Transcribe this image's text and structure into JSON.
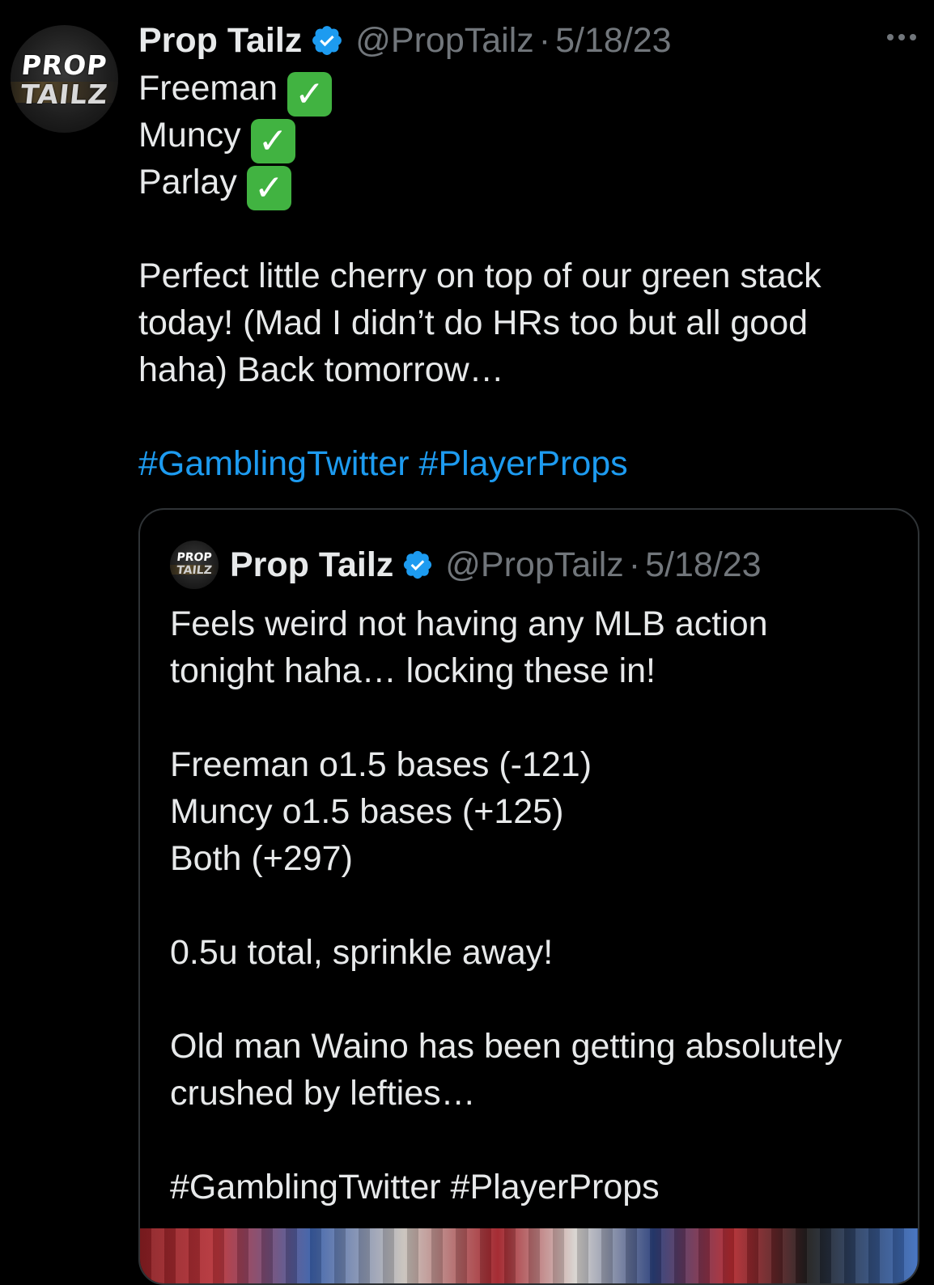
{
  "tweet": {
    "author": {
      "name": "Prop Tailz",
      "handle": "@PropTailz",
      "avatar_text_line1": "PROP",
      "avatar_text_line2": "TAILZ",
      "verified_icon": "verified-badge-icon"
    },
    "separator": "·",
    "date": "5/18/23",
    "more_icon": "more-options-icon",
    "lines": [
      {
        "text": "Freeman",
        "check": "✓"
      },
      {
        "text": "Muncy",
        "check": "✓"
      },
      {
        "text": "Parlay",
        "check": "✓"
      }
    ],
    "paragraph": [
      "Perfect little cherry on top of our green stack",
      "today! (Mad I didn’t do HRs too but all good",
      "haha) Back tomorrow…"
    ],
    "hashtags": [
      "#GamblingTwitter",
      "#PlayerProps"
    ]
  },
  "quoted_tweet": {
    "author": {
      "name": "Prop Tailz",
      "handle": "@PropTailz",
      "avatar_text_line1": "PROP",
      "avatar_text_line2": "TAILZ"
    },
    "separator": "·",
    "date": "5/18/23",
    "intro": [
      "Feels weird not having any MLB action",
      "tonight haha… locking these in!"
    ],
    "picks": [
      "Freeman o1.5 bases (-121)",
      "Muncy o1.5 bases (+125)",
      "Both (+297)"
    ],
    "stake": "0.5u total, sprinkle away!",
    "note": [
      "Old man Waino has been getting absolutely",
      "crushed by lefties…"
    ],
    "hashtags": [
      "#GamblingTwitter",
      "#PlayerProps"
    ]
  },
  "colors": {
    "background": "#000000",
    "text": "#e7e9ea",
    "muted": "#71767b",
    "link": "#1d9bf0",
    "verified": "#1d9bf0",
    "check_bg": "#41b341",
    "border": "#2f3336"
  }
}
